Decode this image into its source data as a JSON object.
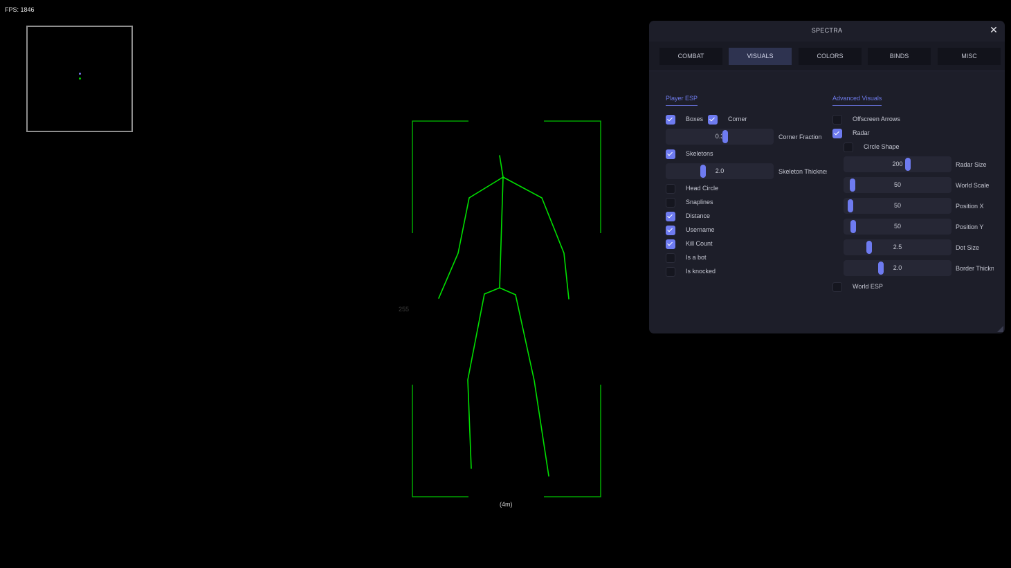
{
  "fps_label": "FPS: 1846",
  "esp": {
    "health_text": "255",
    "distance_text": "(4m)",
    "box_color": "#00c400",
    "skeleton_color": "#00e000"
  },
  "radar": {
    "border_color": "#8e8e8e",
    "dots": [
      {
        "color": "#7a7af0"
      },
      {
        "color": "#00d000"
      }
    ]
  },
  "panel": {
    "title": "SPECTRA",
    "close_icon": "close-icon",
    "tabs": [
      {
        "label": "COMBAT",
        "active": false
      },
      {
        "label": "VISUALS",
        "active": true
      },
      {
        "label": "COLORS",
        "active": false
      },
      {
        "label": "BINDS",
        "active": false
      },
      {
        "label": "MISC",
        "active": false
      }
    ],
    "accent_color": "#6e7bf0",
    "player_esp": {
      "title": "Player ESP",
      "boxes": {
        "label": "Boxes",
        "checked": true
      },
      "corner": {
        "label": "Corner",
        "checked": true
      },
      "corner_fraction": {
        "label": "Corner Fraction",
        "value": "0.3",
        "fraction": 0.3
      },
      "skeletons": {
        "label": "Skeletons",
        "checked": true
      },
      "skeleton_thickness": {
        "label": "Skeleton Thickness",
        "value": "2.0",
        "fraction": 0.2
      },
      "items": [
        {
          "label": "Head Circle",
          "checked": false
        },
        {
          "label": "Snaplines",
          "checked": false
        },
        {
          "label": "Distance",
          "checked": true
        },
        {
          "label": "Username",
          "checked": true
        },
        {
          "label": "Kill Count",
          "checked": true
        },
        {
          "label": "Is a bot",
          "checked": false
        },
        {
          "label": "Is knocked",
          "checked": false
        }
      ]
    },
    "advanced_visuals": {
      "title": "Advanced Visuals",
      "offscreen_arrows": {
        "label": "Offscreen Arrows",
        "checked": false
      },
      "radar": {
        "label": "Radar",
        "checked": true
      },
      "circle_shape": {
        "label": "Circle Shape",
        "checked": false
      },
      "sliders": [
        {
          "label": "Radar Size",
          "value": "200",
          "fraction": 0.6
        },
        {
          "label": "World Scale",
          "value": "50",
          "fraction": 0.05
        },
        {
          "label": "Position X",
          "value": "50",
          "fraction": 0.03
        },
        {
          "label": "Position Y",
          "value": "50",
          "fraction": 0.06
        },
        {
          "label": "Dot Size",
          "value": "2.5",
          "fraction": 0.24
        },
        {
          "label": "Border Thickness",
          "value": "2.0",
          "fraction": 0.35
        }
      ],
      "world_esp": {
        "label": "World ESP",
        "checked": false
      }
    }
  }
}
